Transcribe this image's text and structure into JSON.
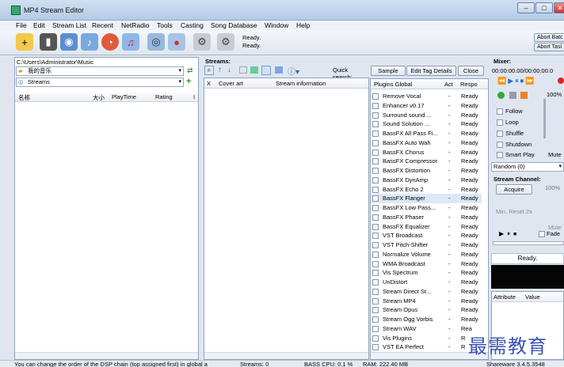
{
  "window": {
    "title": "MP4 Stream Editor"
  },
  "menu": [
    "File",
    "Edit",
    "Stream List",
    "Recent",
    "NetRadio",
    "Tools",
    "Casting",
    "Song Database",
    "Window",
    "Help"
  ],
  "toolbar": {
    "status_line1": "Ready.",
    "status_line2": "Ready.",
    "abort_batch": "Abort Batc",
    "abort_task": "Abort Tasl"
  },
  "browser": {
    "path": "C:\\Users\\Administrator\\Music",
    "folder": "我的音乐",
    "streams_combo": "Streams",
    "columns": [
      "名称",
      "大小",
      "PlayTime",
      "Rating",
      "I"
    ]
  },
  "streams": {
    "label": "Streams:",
    "quick_search_label": "Quick search:",
    "columns": [
      "X",
      "Cover art",
      "Stream information"
    ]
  },
  "plugins": {
    "buttons": {
      "sample": "Sample",
      "edit_tag": "Edit Tag Details",
      "close": "Close"
    },
    "columns": [
      "Plugins Global",
      "Act",
      "Respo"
    ],
    "rows": [
      {
        "name": "Remove Vocal",
        "act": "-",
        "resp": "Ready"
      },
      {
        "name": "Enhancer v0.17",
        "act": "-",
        "resp": "Ready"
      },
      {
        "name": "Surround sound ...",
        "act": "-",
        "resp": "Ready"
      },
      {
        "name": "Sound Solution ...",
        "act": "-",
        "resp": "Ready"
      },
      {
        "name": "BassFX All Pass Fi...",
        "act": "-",
        "resp": "Ready"
      },
      {
        "name": "BassFX Auto Wah",
        "act": "-",
        "resp": "Ready"
      },
      {
        "name": "BassFX Chorus",
        "act": "-",
        "resp": "Ready"
      },
      {
        "name": "BassFX Compressor",
        "act": "-",
        "resp": "Ready"
      },
      {
        "name": "BassFX Distortion",
        "act": "-",
        "resp": "Ready"
      },
      {
        "name": "BassFX DynAmp",
        "act": "-",
        "resp": "Ready"
      },
      {
        "name": "BassFX Echo 2",
        "act": "-",
        "resp": "Ready"
      },
      {
        "name": "BassFX Flanger",
        "act": "-",
        "resp": "Ready"
      },
      {
        "name": "BassFX Low Pass...",
        "act": "-",
        "resp": "Ready"
      },
      {
        "name": "BassFX Phaser",
        "act": "-",
        "resp": "Ready"
      },
      {
        "name": "BassFX Equalizer",
        "act": "-",
        "resp": "Ready"
      },
      {
        "name": "VST Broadcast",
        "act": "-",
        "resp": "Ready"
      },
      {
        "name": "VST Pitch-Shifter",
        "act": "-",
        "resp": "Ready"
      },
      {
        "name": "Normalize Volume",
        "act": "-",
        "resp": "Ready"
      },
      {
        "name": "WMA Broadcast",
        "act": "-",
        "resp": "Ready"
      },
      {
        "name": "Vis Spectrum",
        "act": "-",
        "resp": "Ready"
      },
      {
        "name": "UnDistort",
        "act": "-",
        "resp": "Ready"
      },
      {
        "name": "Stream Direct St...",
        "act": "-",
        "resp": "Ready"
      },
      {
        "name": "Stream MP4",
        "act": "-",
        "resp": "Ready"
      },
      {
        "name": "Stream Opus",
        "act": "-",
        "resp": "Ready"
      },
      {
        "name": "Stream Ogg Vorbis",
        "act": "-",
        "resp": "Ready"
      },
      {
        "name": "Stream WAV",
        "act": "-",
        "resp": "Rea"
      },
      {
        "name": "Vis Plugins",
        "act": "-",
        "resp": "R"
      },
      {
        "name": "VST EA Perfect",
        "act": "-",
        "resp": "R"
      }
    ]
  },
  "mixer": {
    "label": "Mixer:",
    "time": "00:00:00.00/00:00:00.0",
    "volume": "100%",
    "checkboxes": [
      "Follow",
      "Loop",
      "Shuffle",
      "Shutdown",
      "Smart Play"
    ],
    "mute": "Mute",
    "random_combo": "Random (0)",
    "stream_channel": "Stream Channel:",
    "acquire": "Acquire",
    "channel_volume": "100%",
    "min_reset": "Min. Reset 2x",
    "mute2": "Mute",
    "fade": "Fade",
    "status": "Ready.",
    "attr_columns": [
      "Attribute",
      "Value"
    ]
  },
  "statusbar": {
    "hint": "You can change the order of the DSP chain (top assigned first) in global a",
    "streams": "Streams: 0",
    "cpu": "BASS CPU: 0.1 %",
    "ram": "RAM: 222.40 MB",
    "version": "Shareware 3.4.5.3548"
  },
  "watermark": "最需教育"
}
